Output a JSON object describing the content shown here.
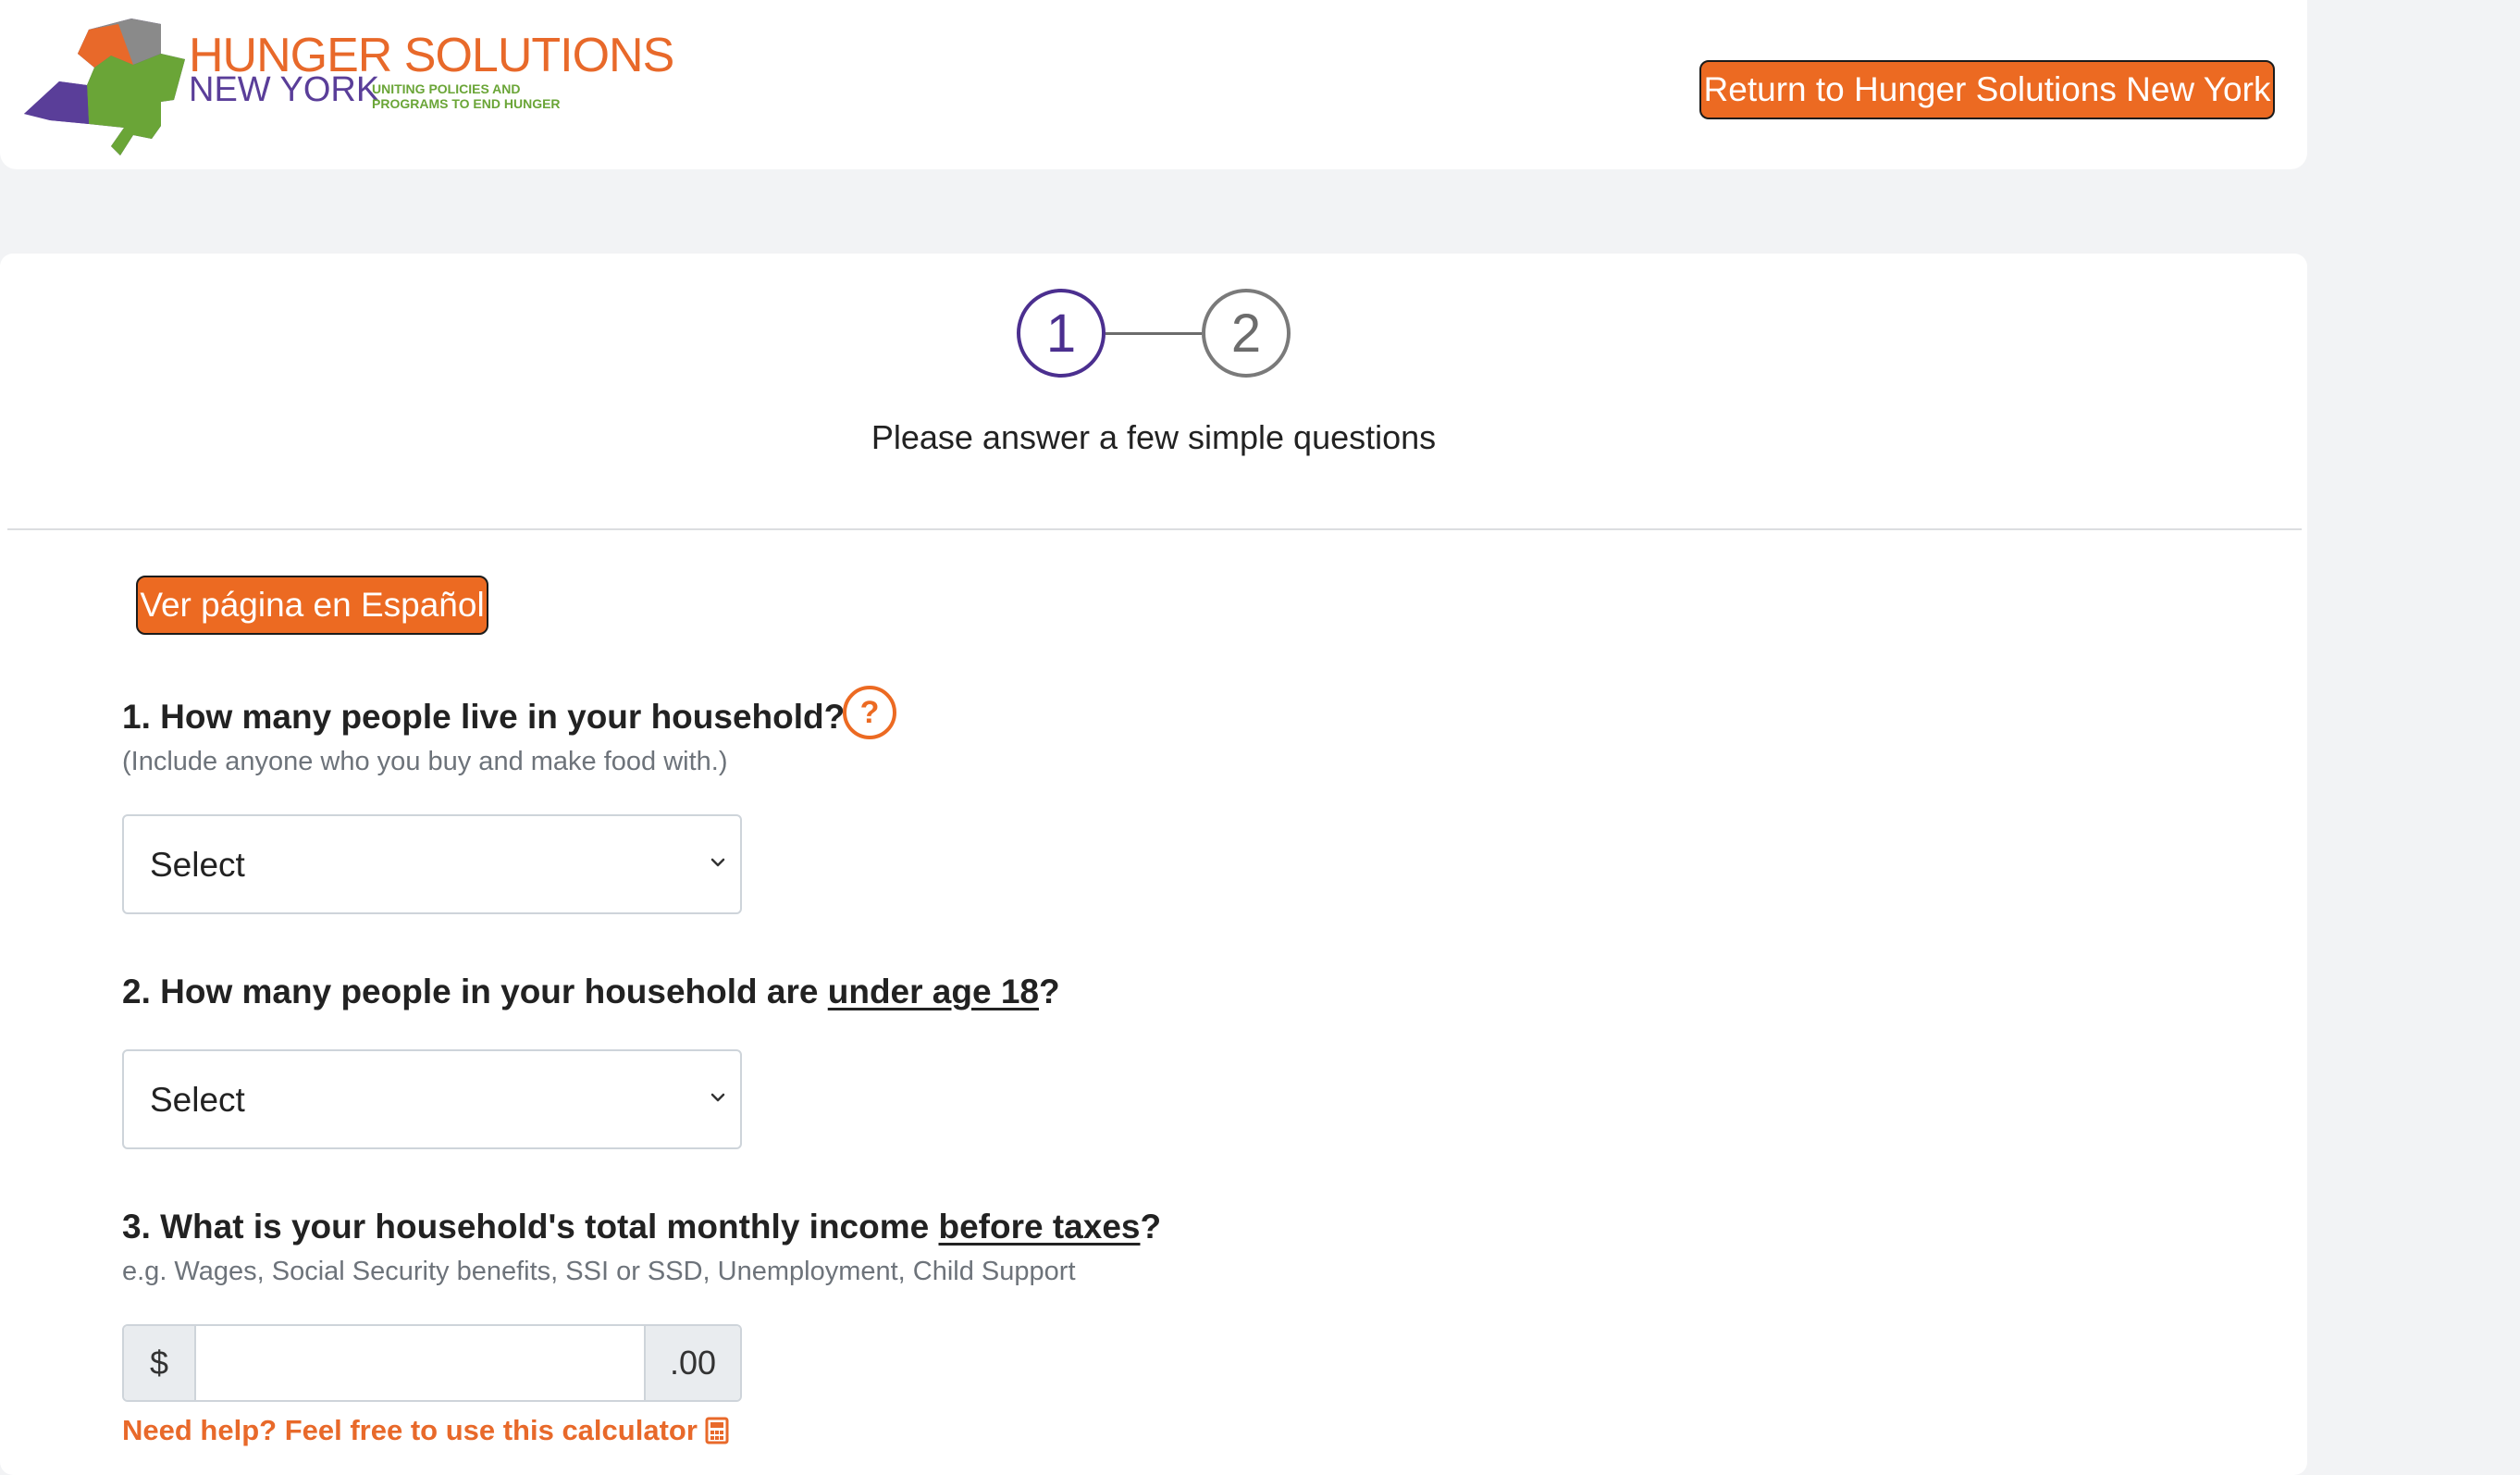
{
  "header": {
    "logo_title": "HUNGER SOLUTIONS",
    "logo_subtitle": "NEW YORK",
    "logo_tagline": "UNITING POLICIES AND\nPROGRAMS TO END HUNGER",
    "return_button": "Return to Hunger Solutions New York"
  },
  "stepper": {
    "steps": [
      "1",
      "2"
    ],
    "active_step": 1,
    "caption": "Please answer a few simple questions"
  },
  "form": {
    "language_button": "Ver página en Español",
    "q1": {
      "label": "1. How many people live in your household?",
      "hint": "(Include anyone who you buy and make food with.)",
      "select_value": "Select"
    },
    "q2": {
      "label_prefix": "2. How many people in your household are ",
      "label_emphasis": "under age 18",
      "label_suffix": "?",
      "select_value": "Select"
    },
    "q3": {
      "label_prefix": "3. What is your household's total monthly income ",
      "label_emphasis": "before taxes",
      "label_suffix": "?",
      "hint": "e.g. Wages, Social Security benefits, SSI or SSD, Unemployment, Child Support",
      "currency_prefix": "$",
      "currency_suffix": ".00",
      "input_value": ""
    },
    "calculator_link": "Need help? Feel free to use this calculator"
  },
  "icons": {
    "help": "question-circle-icon",
    "calculator": "calculator-icon",
    "chevron": "chevron-down-icon"
  },
  "colors": {
    "accent_orange": "#ec6a22",
    "step_active": "#4b2f8f",
    "step_inactive": "#6c6c6c",
    "background": "#f2f3f5"
  }
}
